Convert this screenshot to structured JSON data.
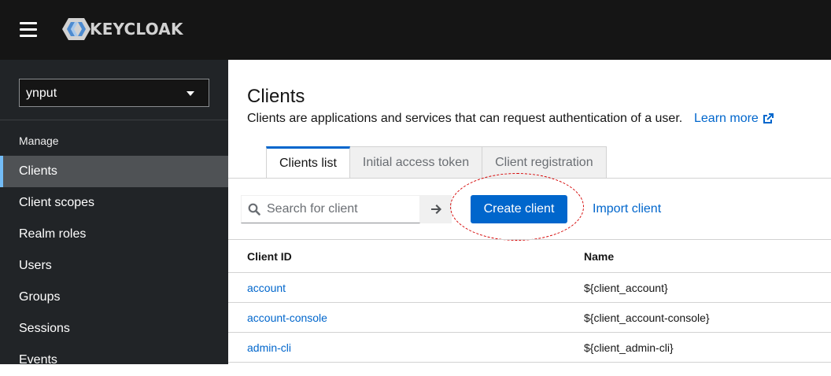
{
  "header": {
    "logo_text": "KEYCLOAK",
    "colors": {
      "background": "#151515",
      "logo_light": "#d2d2d2",
      "logo_accent": "#4d8bd0"
    }
  },
  "sidebar": {
    "realm": "ynput",
    "section_label": "Manage",
    "items": [
      {
        "label": "Clients",
        "active": true
      },
      {
        "label": "Client scopes",
        "active": false
      },
      {
        "label": "Realm roles",
        "active": false
      },
      {
        "label": "Users",
        "active": false
      },
      {
        "label": "Groups",
        "active": false
      },
      {
        "label": "Sessions",
        "active": false
      },
      {
        "label": "Events",
        "active": false
      }
    ]
  },
  "main": {
    "title": "Clients",
    "description": "Clients are applications and services that can request authentication of a user.",
    "learn_more": "Learn more",
    "tabs": [
      {
        "label": "Clients list",
        "active": true
      },
      {
        "label": "Initial access token",
        "active": false
      },
      {
        "label": "Client registration",
        "active": false
      }
    ],
    "search": {
      "placeholder": "Search for client",
      "value": ""
    },
    "create_button": "Create client",
    "import_link": "Import client",
    "table": {
      "columns": [
        "Client ID",
        "Name"
      ],
      "rows": [
        {
          "client_id": "account",
          "name": "${client_account}"
        },
        {
          "client_id": "account-console",
          "name": "${client_account-console}"
        },
        {
          "client_id": "admin-cli",
          "name": "${client_admin-cli}"
        }
      ]
    }
  },
  "colors": {
    "link": "#0066cc",
    "primary_button": "#0066cc",
    "annotation_circle": "#d40000",
    "sidebar": "#212427"
  }
}
